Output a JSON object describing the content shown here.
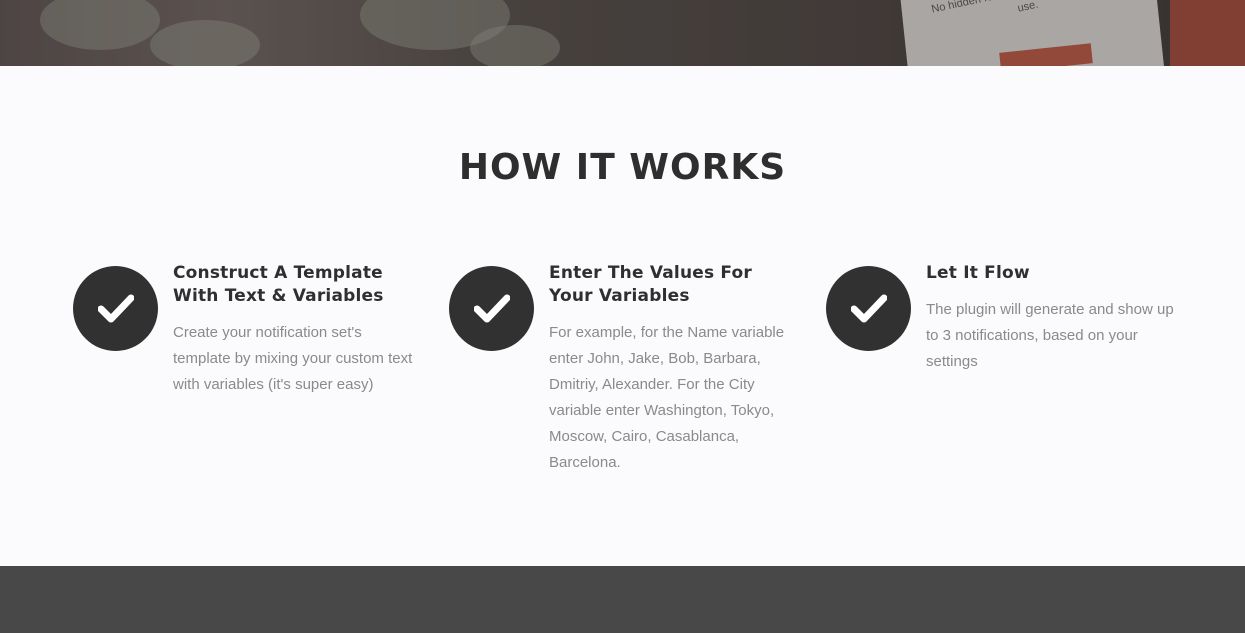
{
  "hero": {
    "card_text": "No hidden fees. No pressure. Personal use."
  },
  "section": {
    "title": "HOW IT WORKS"
  },
  "steps": [
    {
      "icon": "check-icon",
      "heading": "Construct A Template With Text & Variables",
      "body": "Create your notification set's template by mixing your custom text with variables (it's super easy)"
    },
    {
      "icon": "check-icon",
      "heading": "Enter The Values For Your Variables",
      "body": "For example, for the Name variable enter John, Jake, Bob, Barbara, Dmitriy, Alexander. For the City variable enter Washington, Tokyo, Moscow, Cairo, Casablanca, Barcelona."
    },
    {
      "icon": "check-icon",
      "heading": "Let It Flow",
      "body": "The plugin will generate and show up to 3 notifications, based on your settings"
    }
  ],
  "colors": {
    "icon_circle": "#313131",
    "heading": "#2f2f2f",
    "body_text": "#8a8a8a",
    "page_bg": "#fbfbfd",
    "footer_band": "#484848"
  }
}
